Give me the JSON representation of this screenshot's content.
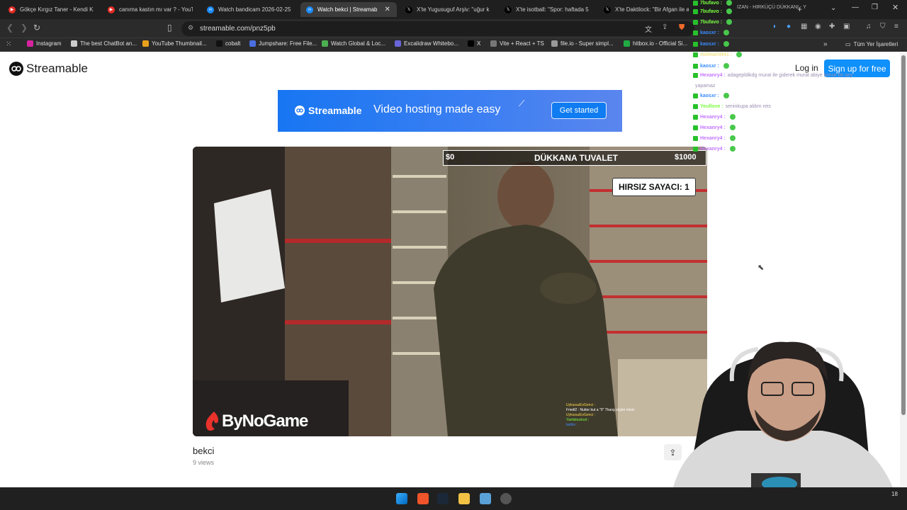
{
  "browser": {
    "tabs": [
      {
        "title": "Gökçe Kırgız Taner - Kendi Ke",
        "icon": "youtube-icon",
        "color": "#e52d27"
      },
      {
        "title": "canıma kastın mı var ? - YouTu",
        "icon": "youtube-icon",
        "color": "#e52d27"
      },
      {
        "title": "Watch bandicam 2026-02-25",
        "icon": "streamable-icon",
        "color": "#1d8cf8"
      },
      {
        "title": "Watch bekci | Streamab",
        "icon": "streamable-icon",
        "color": "#1d8cf8",
        "active": true
      },
      {
        "title": "X'te Yugusuguf Arşiv: \"uğur k",
        "icon": "x-icon",
        "color": "#000000"
      },
      {
        "title": "X'te isotball: \"Spor: haftada 5 t",
        "icon": "x-icon",
        "color": "#000000"
      },
      {
        "title": "X'te Daktilock: \"Bir Afgan ile a",
        "icon": "x-icon",
        "color": "#000000"
      }
    ],
    "new_tab": "+",
    "url": "streamable.com/pnz5pb",
    "bookmarks": [
      {
        "label": "Instagram",
        "color": "#d6249f"
      },
      {
        "label": "The best ChatBot an...",
        "color": "#cccccc"
      },
      {
        "label": "YouTube Thumbnail...",
        "color": "#e8a11c"
      },
      {
        "label": "cobalt",
        "color": "#111111"
      },
      {
        "label": "Jumpshare: Free File...",
        "color": "#4b6fe0"
      },
      {
        "label": "Watch Global & Loc...",
        "color": "#4caf50"
      },
      {
        "label": "Excalidraw Whitebo...",
        "color": "#6965db"
      },
      {
        "label": "X",
        "color": "#000000"
      },
      {
        "label": "Vite + React + TS",
        "color": "#777777"
      },
      {
        "label": "file.io - Super simpl...",
        "color": "#999999"
      },
      {
        "label": "hitbox.io - Official Si...",
        "color": "#22aa44"
      }
    ],
    "bookmarks_more": "»",
    "all_bookmarks": "Tüm Yer İşaretleri"
  },
  "site": {
    "logo": "Streamable",
    "login": "Log in",
    "signup": "Sign up for free",
    "banner": {
      "brand": "Streamable",
      "tagline": "Video hosting made easy",
      "cta": "Get started"
    },
    "video": {
      "hud_left": "$0",
      "hud_title": "DÜKKANA TUVALET",
      "hud_right": "$1000",
      "counter": "HIRSIZ SAYACI: 1",
      "watermark": "ByNoGame",
      "mini_chat": [
        "UykusuzEvGenci :",
        "Friedl2 : Nutter but a \"0\" Thang söyler misin",
        "UykusuzEvGenci :",
        "Yanlisbozkurt :",
        "katlim :"
      ]
    },
    "title": "bekci",
    "views": "9 views"
  },
  "stream_chat": [
    {
      "user": "7bufavo :",
      "msg": "",
      "color": "#7aff3f"
    },
    {
      "user": "7bufavo :",
      "msg": "",
      "color": "#7aff3f"
    },
    {
      "user": "7bufavo :",
      "msg": "",
      "color": "#7aff3f"
    },
    {
      "user": "kaosxr :",
      "msg": "",
      "color": "#3a8cff"
    },
    {
      "user": "kaosxr :",
      "msg": "",
      "color": "#3a8cff"
    },
    {
      "user": "millmarti941 :",
      "msg": "",
      "color": "#f0e28b"
    },
    {
      "user": "kaosxr :",
      "msg": "",
      "color": "#3a8cff"
    },
    {
      "user": "Hexanry4 :",
      "msg": "adagepldikdg murat ile giderek murat abiye kimse bir şey",
      "color": "#c275ff"
    },
    {
      "user": "",
      "msg": "yapamaz",
      "color": "#c275ff"
    },
    {
      "user": "kaosxr :",
      "msg": "",
      "color": "#3a8cff"
    },
    {
      "user": "Yeullove :",
      "msg": "seninkupa aldım reis",
      "color": "#7aff3f"
    },
    {
      "user": "Hexanry4 :",
      "msg": "",
      "color": "#c275ff"
    },
    {
      "user": "Hexanry4 :",
      "msg": "",
      "color": "#c275ff"
    },
    {
      "user": "Hexanry4 :",
      "msg": "",
      "color": "#c275ff"
    },
    {
      "user": "Hexanry4 :",
      "msg": "",
      "color": "#c275ff"
    }
  ],
  "stream_header": "IZAN - HIRKÜÇÜ DÜKKANI - Y",
  "taskbar_clock": "18"
}
